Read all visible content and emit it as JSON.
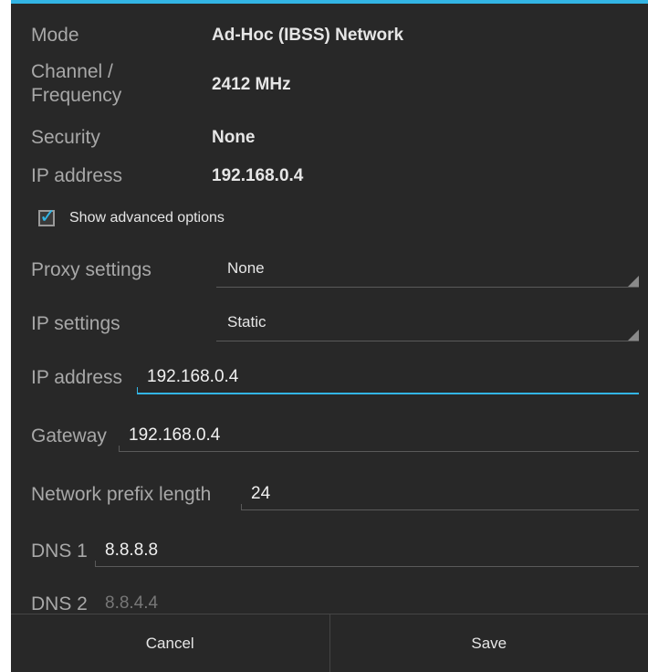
{
  "info": [
    {
      "label": "Mode",
      "value": "Ad-Hoc (IBSS) Network"
    },
    {
      "label_line1": "Channel /",
      "label_line2": "Frequency",
      "value": "2412 MHz"
    },
    {
      "label": "Security",
      "value": "None"
    },
    {
      "label": "IP address",
      "value": "192.168.0.4"
    }
  ],
  "advanced": {
    "checked": true,
    "label": "Show advanced options"
  },
  "proxy": {
    "label": "Proxy settings",
    "value": "None"
  },
  "ip_settings": {
    "label": "IP settings",
    "value": "Static"
  },
  "fields": {
    "ip_address": {
      "label": "IP address",
      "value": "192.168.0.4"
    },
    "gateway": {
      "label": "Gateway",
      "value": "192.168.0.4"
    },
    "prefix": {
      "label": "Network prefix length",
      "value": "24"
    },
    "dns1": {
      "label": "DNS 1",
      "value": "8.8.8.8"
    },
    "dns2": {
      "label": "DNS 2",
      "hint": "8.8.4.4"
    }
  },
  "buttons": {
    "cancel": "Cancel",
    "save": "Save"
  },
  "colors": {
    "accent": "#33b5e5",
    "background": "#282828"
  }
}
